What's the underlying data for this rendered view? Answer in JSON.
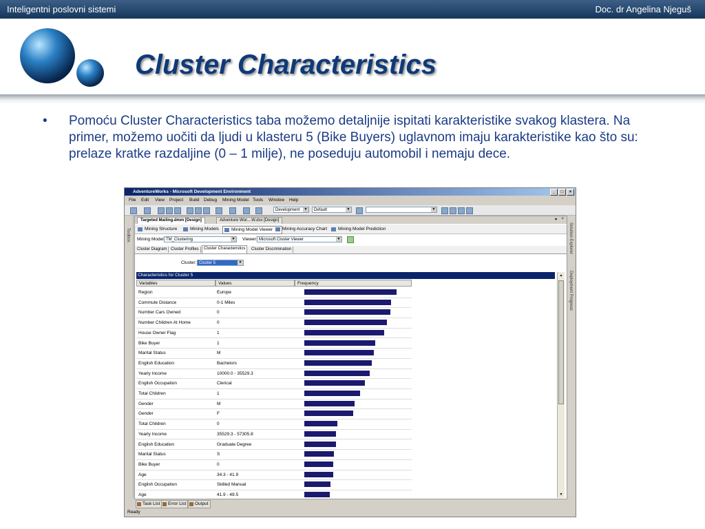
{
  "slide": {
    "course": "Inteligentni poslovni sistemi",
    "author": "Doc. dr Angelina Njeguš",
    "title": "Cluster Characteristics",
    "bullet_marker": "•",
    "bullet_text": "Pomoću Cluster Characteristics taba možemo detaljnije ispitati karakteristike svakog klastera. Na primer, možemo uočiti da ljudi u klasteru 5 (Bike Buyers) uglavnom imaju karakteristike kao što su: prelaze kratke razdaljine (0 – 1 milje), ne poseduju automobil i nemaju dece."
  },
  "window": {
    "title": "AdventureWorks - Microsoft Development Environment",
    "menu": [
      "File",
      "Edit",
      "View",
      "Project",
      "Build",
      "Debug",
      "Mining Model",
      "Tools",
      "Window",
      "Help"
    ],
    "toolbar": {
      "config": "Development",
      "platform": "Default"
    },
    "left_strip_label": "Toolbox",
    "right_strip_labels": [
      "Solution Explorer",
      "Deployment Progress"
    ],
    "doc_tabs": [
      "Targeted Mailing.dmm [Design]",
      "Adventure Wor....W.dsv [Design]"
    ],
    "designer_tabs": [
      "Mining Structure",
      "Mining Models",
      "Mining Model Viewer",
      "Mining Accuracy Chart",
      "Mining Model Prediction"
    ],
    "mining_model_label": "Mining Model:",
    "mining_model_value": "TM_Clustering",
    "viewer_label": "Viewer:",
    "viewer_value": "Microsoft Cluster Viewer",
    "viewer_tabs": [
      "Cluster Diagram",
      "Cluster Profiles",
      "Cluster Characteristics",
      "Cluster Discrimination"
    ],
    "cluster_label": "Cluster:",
    "cluster_value": "Cluster 5",
    "grid_caption": "Characteristics for Cluster 5",
    "columns": [
      "Variables",
      "Values",
      "Frequency"
    ],
    "rows": [
      {
        "variable": "Region",
        "value": "Europe",
        "frequency": 0.81
      },
      {
        "variable": "Commute Distance",
        "value": "0-1 Miles",
        "frequency": 0.76
      },
      {
        "variable": "Number Cars Owned",
        "value": "0",
        "frequency": 0.75
      },
      {
        "variable": "Number Children At Home",
        "value": "0",
        "frequency": 0.72
      },
      {
        "variable": "House Owner Flag",
        "value": "1",
        "frequency": 0.7
      },
      {
        "variable": "Bike Buyer",
        "value": "1",
        "frequency": 0.62
      },
      {
        "variable": "Marital Status",
        "value": "M",
        "frequency": 0.61
      },
      {
        "variable": "English Education",
        "value": "Bachelors",
        "frequency": 0.59
      },
      {
        "variable": "Yearly Income",
        "value": "10000.0 - 35529.3",
        "frequency": 0.57
      },
      {
        "variable": "English Occupation",
        "value": "Clerical",
        "frequency": 0.53
      },
      {
        "variable": "Total Children",
        "value": "1",
        "frequency": 0.49
      },
      {
        "variable": "Gender",
        "value": "M",
        "frequency": 0.44
      },
      {
        "variable": "Gender",
        "value": "F",
        "frequency": 0.43
      },
      {
        "variable": "Total Children",
        "value": "0",
        "frequency": 0.29
      },
      {
        "variable": "Yearly Income",
        "value": "35529.3 - 57305.8",
        "frequency": 0.28
      },
      {
        "variable": "English Education",
        "value": "Graduate Degree",
        "frequency": 0.28
      },
      {
        "variable": "Marital Status",
        "value": "S",
        "frequency": 0.26
      },
      {
        "variable": "Bike Buyer",
        "value": "0",
        "frequency": 0.25
      },
      {
        "variable": "Age",
        "value": "34.3 - 41.9",
        "frequency": 0.25
      },
      {
        "variable": "English Occupation",
        "value": "Skilled Manual",
        "frequency": 0.23
      },
      {
        "variable": "Age",
        "value": "41.9 - 49.5",
        "frequency": 0.22
      }
    ],
    "bottom_tabs": [
      "Task List",
      "Error List",
      "Output"
    ],
    "status": "Ready"
  },
  "colors": {
    "title": "#0f3a78",
    "text": "#1a3b85",
    "bar": "#1b1a6e",
    "grid_caption": "#0a246a"
  }
}
